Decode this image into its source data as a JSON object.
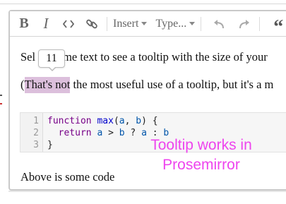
{
  "menubar": {
    "bold_label": "B",
    "italic_label": "I",
    "code_icon": "code-icon",
    "link_icon": "link-icon",
    "insert_label": "Insert",
    "type_label": "Type...",
    "undo_icon": "undo-icon",
    "redo_icon": "redo-icon",
    "quote_label": "“"
  },
  "tooltip": {
    "value": "11"
  },
  "content": {
    "p1_start": "Sel",
    "p1_end": "me text to see a tooltip with the size of your",
    "p2_open": "(",
    "p2_selected": "That's not",
    "p2_rest": " the most useful use of a tooltip, but it's a m",
    "p3": "Above is some code"
  },
  "code": {
    "line_numbers": [
      "1",
      "2",
      "3"
    ],
    "lines": [
      [
        {
          "text": "function",
          "cls": "kw"
        },
        {
          "text": " ",
          "cls": "op"
        },
        {
          "text": "max",
          "cls": "fn"
        },
        {
          "text": "(",
          "cls": "op"
        },
        {
          "text": "a",
          "cls": "var"
        },
        {
          "text": ", ",
          "cls": "op"
        },
        {
          "text": "b",
          "cls": "var"
        },
        {
          "text": ") {",
          "cls": "op"
        }
      ],
      [
        {
          "text": "  ",
          "cls": "op"
        },
        {
          "text": "return",
          "cls": "kw"
        },
        {
          "text": " ",
          "cls": "op"
        },
        {
          "text": "a",
          "cls": "var"
        },
        {
          "text": " > ",
          "cls": "op"
        },
        {
          "text": "b",
          "cls": "var"
        },
        {
          "text": " ? ",
          "cls": "op"
        },
        {
          "text": "a",
          "cls": "var"
        },
        {
          "text": " : ",
          "cls": "op"
        },
        {
          "text": "b",
          "cls": "var"
        }
      ],
      [
        {
          "text": "}",
          "cls": "op"
        }
      ]
    ]
  },
  "annotation": {
    "line1": "Tooltip works in",
    "line2": "Prosemirror"
  },
  "colors": {
    "selection": "#dcbfdc",
    "annotation": "#ee44ee",
    "toolbar_icon": "#666666",
    "code_keyword": "#770088",
    "code_function": "#0000cc",
    "code_variable": "#0055aa"
  }
}
